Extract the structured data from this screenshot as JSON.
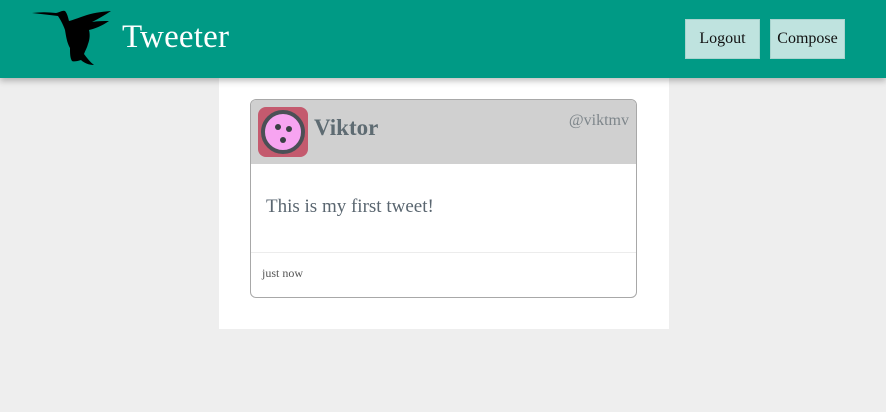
{
  "header": {
    "brand": "Tweeter",
    "logout_label": "Logout",
    "compose_label": "Compose"
  },
  "tweet": {
    "name": "Viktor",
    "handle": "@viktmv",
    "text": "This is my first tweet!",
    "timestamp": "just now"
  },
  "colors": {
    "nav": "#009a85",
    "nav_button": "#bfe3df",
    "tweet_header": "#d0d0d0",
    "avatar_bg": "#c45a6e",
    "avatar_face": "#f7a4f1",
    "page_bg": "#eeeeee"
  },
  "icons": {
    "logo": "hummingbird-icon",
    "avatar": "robot-avatar-icon"
  }
}
